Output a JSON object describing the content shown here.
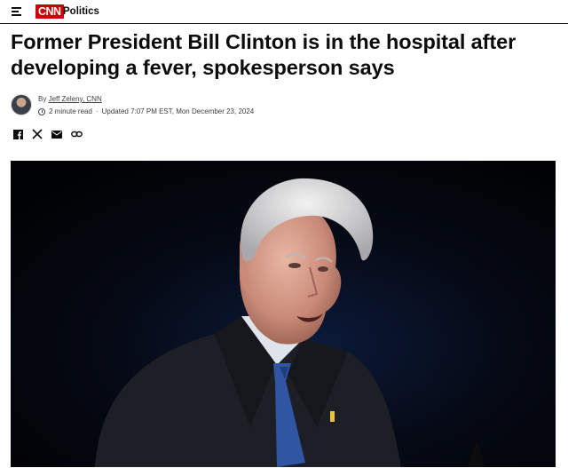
{
  "header": {
    "brand": "CNN",
    "section": "Politics",
    "colors": {
      "brand_red": "#cc0000"
    }
  },
  "article": {
    "headline": "Former President Bill Clinton is in the hospital after developing a fever, spokesperson says",
    "byline_prefix": "By ",
    "author": "Jeff Zeleny, CNN",
    "read_time": "2 minute read",
    "separator": "·",
    "updated": "Updated 7:07 PM EST, Mon December 23, 2024"
  },
  "share": {
    "icons": [
      "facebook-icon",
      "x-icon",
      "email-icon",
      "link-icon"
    ]
  }
}
